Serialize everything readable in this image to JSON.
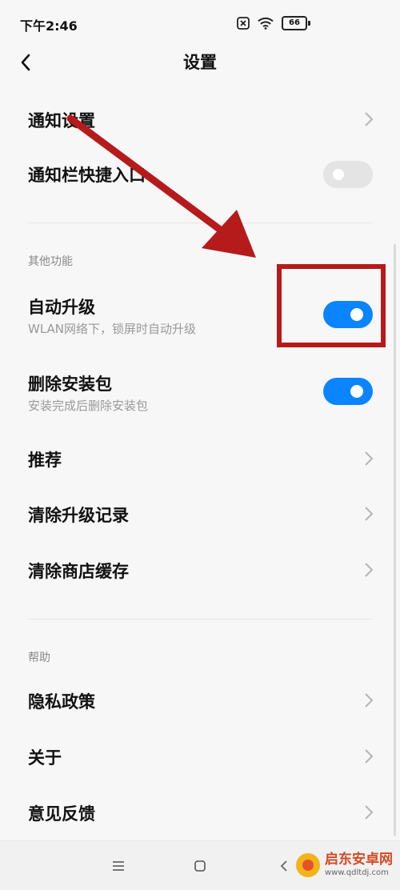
{
  "status_bar": {
    "time": "下午2:46",
    "battery": "66"
  },
  "header": {
    "title": "设置"
  },
  "rows": {
    "notification_settings": "通知设置",
    "notification_shortcut": "通知栏快捷入口",
    "auto_upgrade": {
      "label": "自动升级",
      "subtitle": "WLAN网络下，锁屏时自动升级"
    },
    "delete_package": {
      "label": "删除安装包",
      "subtitle": "安装完成后删除安装包"
    },
    "recommend": "推荐",
    "clear_upgrade_records": "清除升级记录",
    "clear_store_cache": "清除商店缓存",
    "privacy_policy": "隐私政策",
    "about": "关于",
    "feedback": "意见反馈"
  },
  "sections": {
    "other": "其他功能",
    "help": "帮助"
  },
  "toggles": {
    "notification_shortcut": false,
    "auto_upgrade": true,
    "delete_package": true
  },
  "colors": {
    "toggle_on": "#0a84ff",
    "toggle_off": "#e4e4e4",
    "annotation": "#b51b1b"
  },
  "icons": {
    "back": "chevron-left-icon",
    "nav_menu": "menu-icon",
    "nav_home": "home-square-icon",
    "nav_back": "back-triangle-icon"
  },
  "watermark": {
    "name": "启东安卓网",
    "url": "www.qdltdj.com"
  }
}
